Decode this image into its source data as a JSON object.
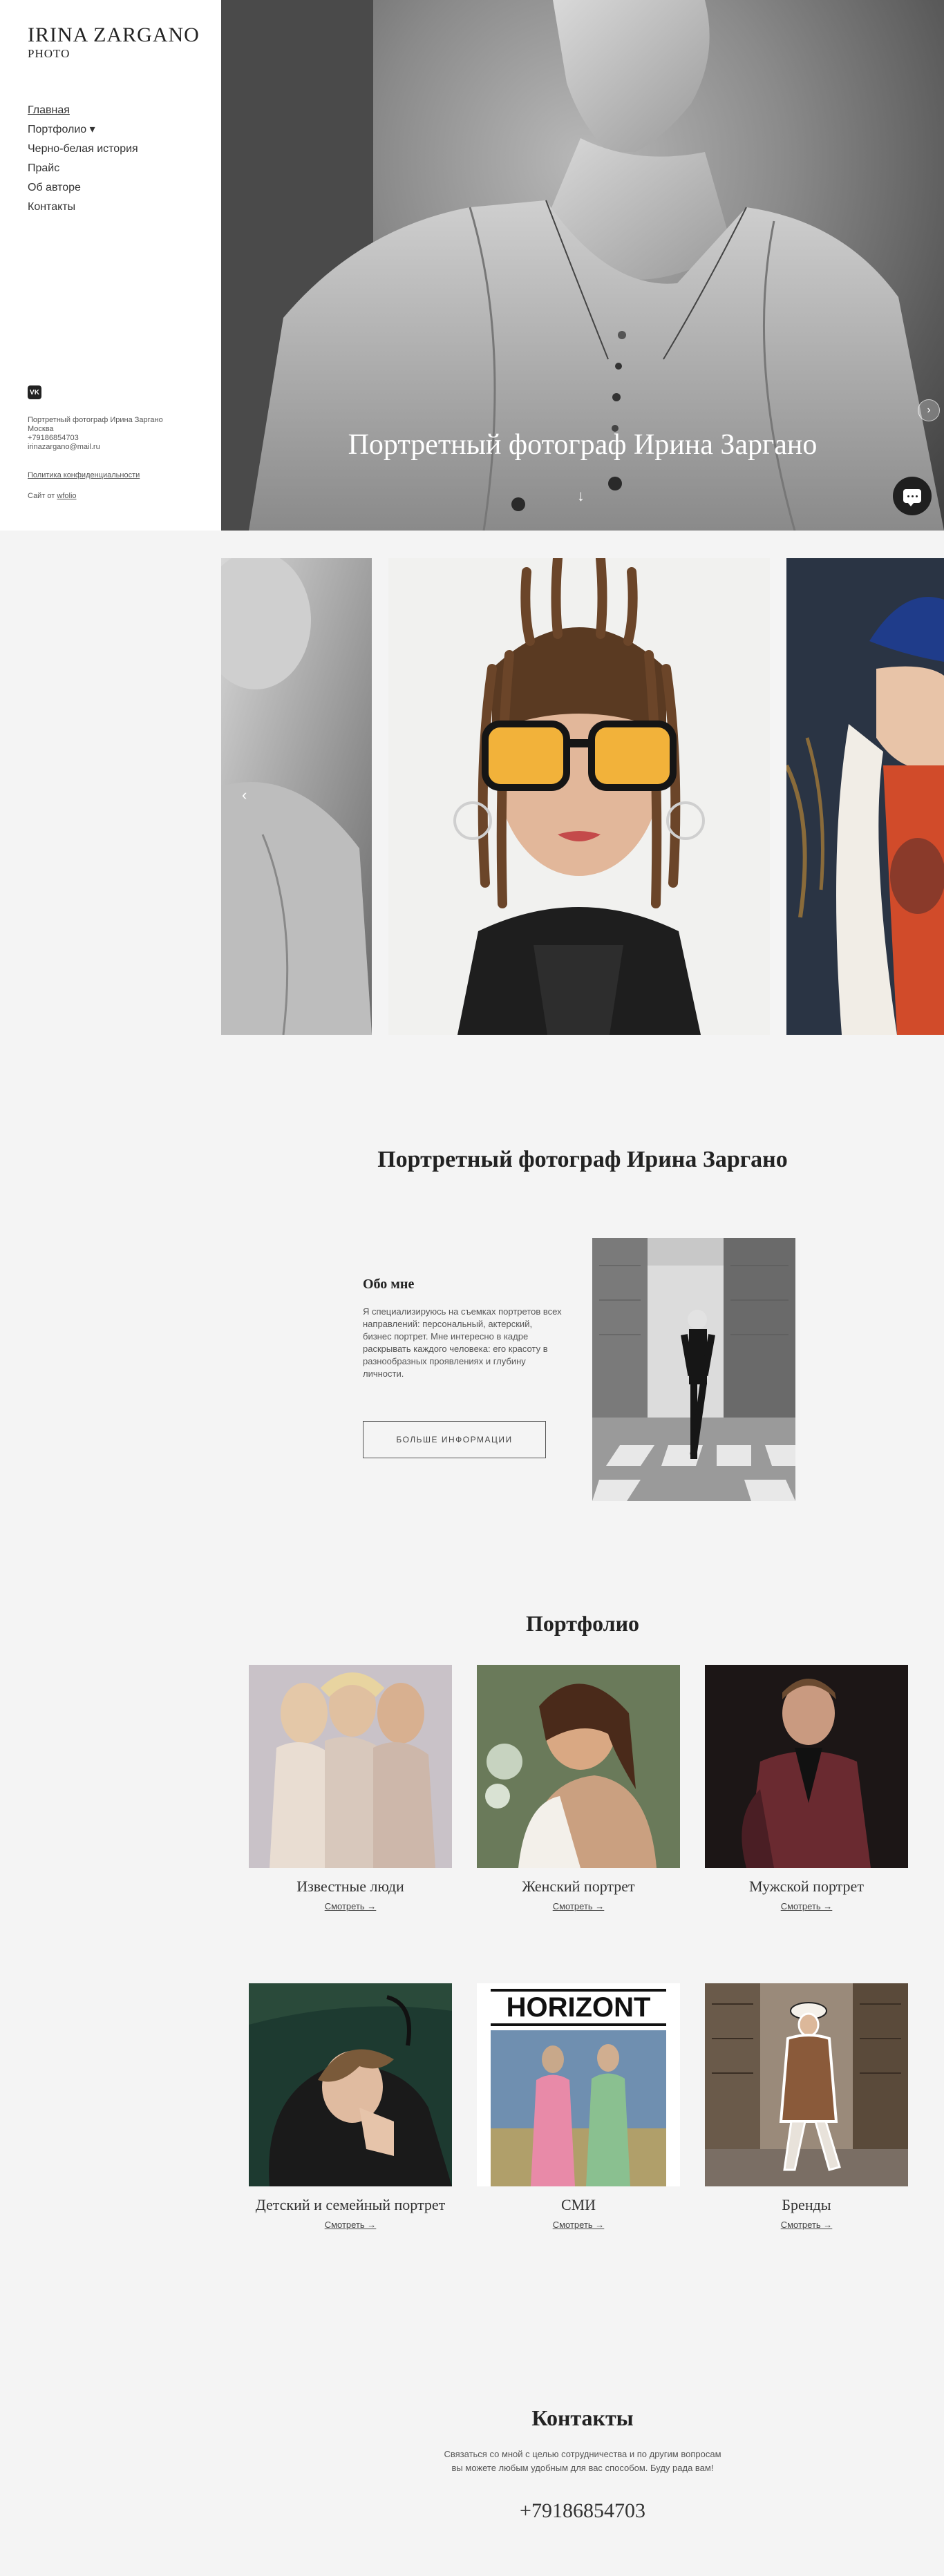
{
  "brand": {
    "name": "IRINA ZARGANO",
    "sub": "PHOTO"
  },
  "nav": [
    {
      "label": "Главная"
    },
    {
      "label": "Портфолио ▾"
    },
    {
      "label": "Черно-белая история"
    },
    {
      "label": "Прайс"
    },
    {
      "label": "Об авторе"
    },
    {
      "label": "Контакты"
    }
  ],
  "sidebar": {
    "vk_icon": "vk-icon",
    "vk_text": "VK",
    "info_lines": [
      "Портретный фотограф Ирина Заргано",
      "Москва",
      "+79186854703",
      "irinazargano@mail.ru"
    ],
    "policy": "Политика конфиденциальности",
    "made_by_prefix": "Сайт от",
    "made_by_link": "wfolio"
  },
  "hero": {
    "title": "Портретный фотограф Ирина Заргано",
    "arrow": "↓",
    "next": "›",
    "chat_icon": "chat-icon"
  },
  "gallery": {
    "prev": "‹"
  },
  "intro": {
    "title": "Портретный фотограф Ирина Заргано",
    "about_title": "Обо мне",
    "about_text": "Я специализируюсь на съемках портретов всех направлений: персональный, актерский, бизнес портрет. Мне интересно в кадре раскрывать каждого человека: его красоту в разнообразных проявлениях и глубину личности.",
    "more_button": "БОЛЬШЕ ИНФОРМАЦИИ"
  },
  "portfolio": {
    "title": "Портфолио",
    "items": [
      {
        "name": "Известные люди",
        "link": "Смотреть →"
      },
      {
        "name": "Женский портрет",
        "link": "Смотреть →"
      },
      {
        "name": "Мужской портрет",
        "link": "Смотреть →"
      },
      {
        "name": "Детский и семейный портрет",
        "link": "Смотреть →"
      },
      {
        "name": "СМИ",
        "link": "Смотреть →"
      },
      {
        "name": "Бренды",
        "link": "Смотреть →"
      }
    ],
    "magazine_logo": "HORIZONT"
  },
  "contacts": {
    "title": "Контакты",
    "text_line1": "Связаться со мной с целью сотрудничества и по другим вопросам",
    "text_line2": "вы можете любым удобным для вас способом. Буду рада вам!",
    "phone": "+79186854703"
  }
}
